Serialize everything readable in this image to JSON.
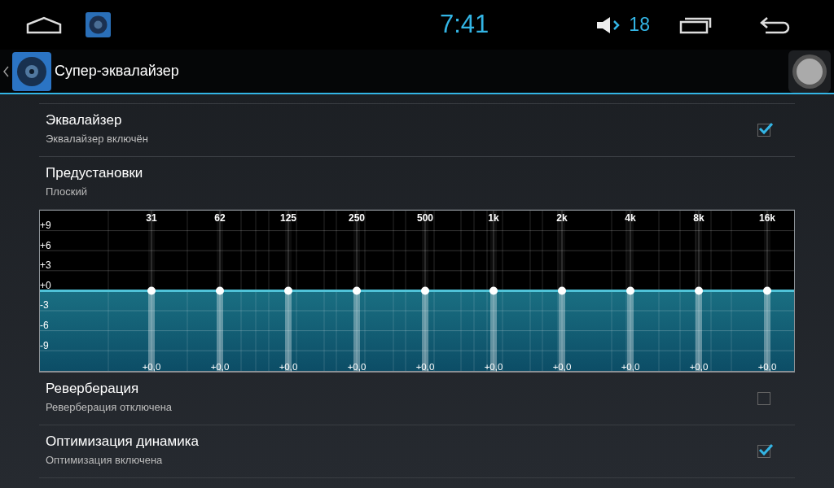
{
  "status_bar": {
    "time": "7:41",
    "volume": "18"
  },
  "action_bar": {
    "title": "Супер-эквалайзер"
  },
  "settings": [
    {
      "kind": "toggle",
      "title": "Эквалайзер",
      "summary": "Эквалайзер включён",
      "checked": true
    },
    {
      "kind": "plain",
      "title": "Предустановки",
      "summary": "Плоский"
    }
  ],
  "equalizer": {
    "y_labels": [
      "+9",
      "+6",
      "+3",
      "+0",
      "-3",
      "-6",
      "-9"
    ],
    "bands": [
      {
        "freq": "31",
        "reading": "+0,0",
        "level": 0.5
      },
      {
        "freq": "62",
        "reading": "+0,0",
        "level": 0.5
      },
      {
        "freq": "125",
        "reading": "+0,0",
        "level": 0.5
      },
      {
        "freq": "250",
        "reading": "+0,0",
        "level": 0.5
      },
      {
        "freq": "500",
        "reading": "+0,0",
        "level": 0.5
      },
      {
        "freq": "1k",
        "reading": "+0,0",
        "level": 0.5
      },
      {
        "freq": "2k",
        "reading": "+0,0",
        "level": 0.5
      },
      {
        "freq": "4k",
        "reading": "+0,0",
        "level": 0.5
      },
      {
        "freq": "8k",
        "reading": "+0,0",
        "level": 0.5
      },
      {
        "freq": "16k",
        "reading": "+0,0",
        "level": 0.5
      }
    ]
  },
  "settings_after": [
    {
      "kind": "toggle",
      "title": "Реверберация",
      "summary": "Реверберация отключена",
      "checked": false
    },
    {
      "kind": "toggle",
      "title": "Оптимизация динамика",
      "summary": "Оптимизация включена",
      "checked": true
    }
  ]
}
